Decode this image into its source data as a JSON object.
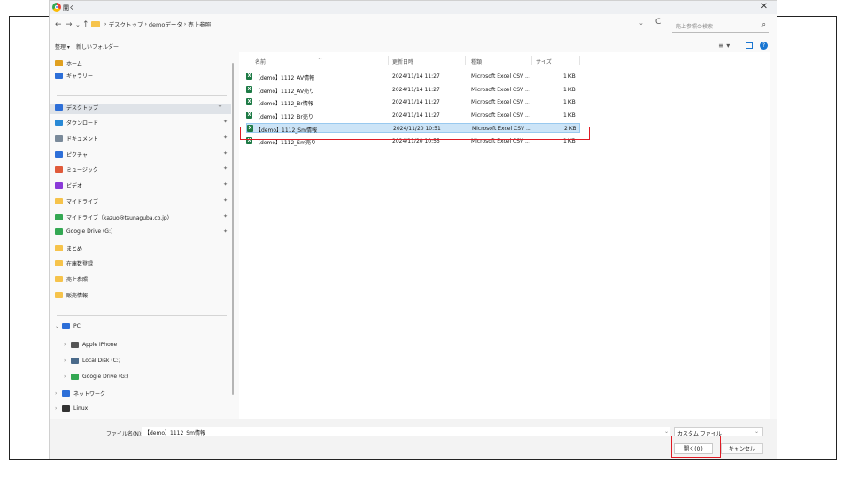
{
  "window": {
    "title": "開く",
    "close_label": "✕"
  },
  "nav": {
    "back": "←",
    "forward": "→",
    "recent": "⌄",
    "up": "↑",
    "refresh": "C",
    "dropdown": "⌄"
  },
  "breadcrumb": {
    "sep": "›",
    "items": [
      "デスクトップ",
      "demoデータ",
      "売上参照"
    ]
  },
  "search": {
    "placeholder": "売上参照の検索",
    "icon": "⌕"
  },
  "toolbar": {
    "organize": "整理 ▾",
    "new_folder": "新しいフォルダー",
    "view": "≡ ▾",
    "help": "?"
  },
  "sidebar": {
    "items": [
      {
        "label": "ホーム",
        "icon": "home-icon",
        "color": "#e0a020"
      },
      {
        "label": "ギャラリー",
        "icon": "gallery-icon",
        "color": "#2d6fd8"
      },
      {
        "label": "デスクトップ",
        "icon": "desktop-icon",
        "color": "#2d6fd8",
        "pinned": true,
        "selected": true
      },
      {
        "label": "ダウンロード",
        "icon": "download-icon",
        "color": "#2a8ad6",
        "pinned": true
      },
      {
        "label": "ドキュメント",
        "icon": "document-icon",
        "color": "#7a8a9a",
        "pinned": true
      },
      {
        "label": "ピクチャ",
        "icon": "picture-icon",
        "color": "#2d6fd8",
        "pinned": true
      },
      {
        "label": "ミュージック",
        "icon": "music-icon",
        "color": "#e05a3a",
        "pinned": true
      },
      {
        "label": "ビデオ",
        "icon": "video-icon",
        "color": "#8a3ad8",
        "pinned": true
      },
      {
        "label": "マイドライブ",
        "icon": "folder-icon",
        "color": "#f6c34b",
        "pinned": true
      },
      {
        "label": "マイドライブ（kazuo@tsunaguba.co.jp）",
        "icon": "google-drive-icon",
        "color": "#34a853",
        "pinned": true
      },
      {
        "label": "Google Drive (G:)",
        "icon": "google-drive-icon",
        "color": "#34a853",
        "pinned": true
      },
      {
        "label": "まとめ",
        "icon": "folder-icon",
        "color": "#f6c34b"
      },
      {
        "label": "在庫数登録",
        "icon": "folder-icon",
        "color": "#f6c34b"
      },
      {
        "label": "売上参照",
        "icon": "folder-icon",
        "color": "#f6c34b"
      },
      {
        "label": "販売情報",
        "icon": "folder-icon",
        "color": "#f6c34b"
      }
    ],
    "tree": [
      {
        "label": "PC",
        "arrow": "⌄",
        "icon": "pc-icon",
        "color": "#2d6fd8",
        "indent": 0
      },
      {
        "label": "Apple iPhone",
        "arrow": "›",
        "icon": "iphone-icon",
        "color": "#555555",
        "indent": 1
      },
      {
        "label": "Local Disk (C:)",
        "arrow": "›",
        "icon": "disk-icon",
        "color": "#4a6a8a",
        "indent": 1
      },
      {
        "label": "Google Drive (G:)",
        "arrow": "›",
        "icon": "google-drive-icon",
        "color": "#34a853",
        "indent": 1
      },
      {
        "label": "ネットワーク",
        "arrow": "›",
        "icon": "network-icon",
        "color": "#2d6fd8",
        "indent": 0
      },
      {
        "label": "Linux",
        "arrow": "›",
        "icon": "linux-icon",
        "color": "#333333",
        "indent": 0
      }
    ]
  },
  "columns": {
    "name": "名前",
    "date": "更新日時",
    "type": "種類",
    "size": "サイズ",
    "sort": "^"
  },
  "files": [
    {
      "name": "【demo】1112_AV情報",
      "date": "2024/11/14 11:27",
      "type": "Microsoft Excel CSV ...",
      "size": "1 KB"
    },
    {
      "name": "【demo】1112_AV売り",
      "date": "2024/11/14 11:27",
      "type": "Microsoft Excel CSV ...",
      "size": "1 KB"
    },
    {
      "name": "【demo】1112_Br情報",
      "date": "2024/11/14 11:27",
      "type": "Microsoft Excel CSV ...",
      "size": "1 KB"
    },
    {
      "name": "【demo】1112_Br売り",
      "date": "2024/11/14 11:27",
      "type": "Microsoft Excel CSV ...",
      "size": "1 KB"
    },
    {
      "name": "【demo】1112_Sm情報",
      "date": "2024/11/20 10:51",
      "type": "Microsoft Excel CSV ...",
      "size": "2 KB",
      "selected": true
    },
    {
      "name": "【demo】1112_Sm売り",
      "date": "2024/11/20 10:55",
      "type": "Microsoft Excel CSV ...",
      "size": "1 KB"
    }
  ],
  "footer": {
    "filename_label": "ファイル名(N):",
    "filename_value": "【demo】1112_Sm情報",
    "filter": "カスタム ファイル",
    "open": "開く(O)",
    "cancel": "キャンセル",
    "dropdown": "⌄"
  },
  "colors": {
    "selected_row": "#cce4f7",
    "highlight": "#e01b24",
    "accent": "#1976d2",
    "excel": "#1d7a45"
  }
}
